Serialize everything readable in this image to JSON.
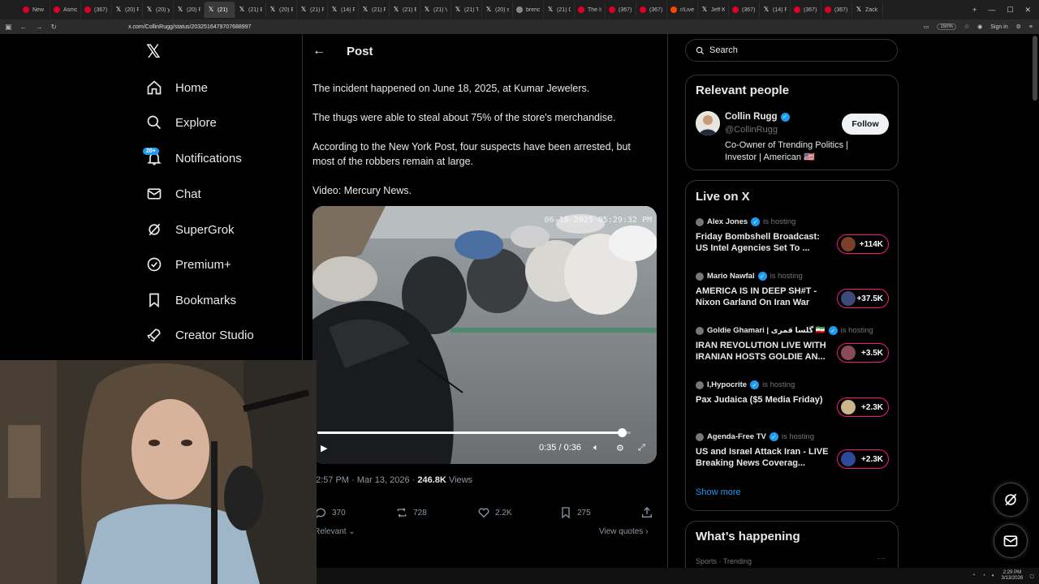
{
  "browser": {
    "tabs": [
      {
        "label": "New",
        "icon": "youtube"
      },
      {
        "label": "Asmo",
        "icon": "youtube"
      },
      {
        "label": "(367)",
        "icon": "youtube"
      },
      {
        "label": "(20) F",
        "icon": "x"
      },
      {
        "label": "(20) y",
        "icon": "x"
      },
      {
        "label": "(20) F",
        "icon": "x"
      },
      {
        "label": "(21) ",
        "icon": "x",
        "active": true
      },
      {
        "label": "(21) E",
        "icon": "x"
      },
      {
        "label": "(20) E",
        "icon": "x"
      },
      {
        "label": "(21) F",
        "icon": "x"
      },
      {
        "label": "(14) F",
        "icon": "x"
      },
      {
        "label": "(21) F",
        "icon": "x"
      },
      {
        "label": "(21) E",
        "icon": "x"
      },
      {
        "label": "(21) V",
        "icon": "x"
      },
      {
        "label": "(21) T",
        "icon": "x"
      },
      {
        "label": "(20) s",
        "icon": "x"
      },
      {
        "label": "brenc",
        "icon": "globe"
      },
      {
        "label": "(21) C",
        "icon": "x"
      },
      {
        "label": "The Is",
        "icon": "youtube"
      },
      {
        "label": "(367)",
        "icon": "youtube"
      },
      {
        "label": "(367)",
        "icon": "youtube"
      },
      {
        "label": "r/Livel",
        "icon": "reddit"
      },
      {
        "label": "Jeff K",
        "icon": "x"
      },
      {
        "label": "(367)",
        "icon": "youtube"
      },
      {
        "label": "(14) F",
        "icon": "x"
      },
      {
        "label": "(367)",
        "icon": "youtube"
      },
      {
        "label": "(367)",
        "icon": "youtube"
      },
      {
        "label": "Zack",
        "icon": "x"
      }
    ],
    "url": "x.com/CollinRugg/status/2032516479707688997",
    "zoom": "150%",
    "signin_label": "Sign in"
  },
  "nav": {
    "items": [
      {
        "label": "Home",
        "icon": "home-icon"
      },
      {
        "label": "Explore",
        "icon": "search-icon"
      },
      {
        "label": "Notifications",
        "icon": "bell-icon"
      },
      {
        "label": "Chat",
        "icon": "mail-icon"
      },
      {
        "label": "SuperGrok",
        "icon": "grok-icon"
      },
      {
        "label": "Premium+",
        "icon": "verified-badge-icon"
      },
      {
        "label": "Bookmarks",
        "icon": "bookmark-icon"
      },
      {
        "label": "Creator Studio",
        "icon": "rocket-icon"
      }
    ],
    "notifications_badge": "20+"
  },
  "post": {
    "header_title": "Post",
    "paragraphs": [
      "The incident happened on June 18, 2025, at Kumar Jewelers.",
      "The thugs were able to steal about 75% of the store's merchandise.",
      "According to the New York Post, four suspects have been arrested, but most of the robbers remain at large.",
      "Video: Mercury News."
    ],
    "video": {
      "timestamp_overlay": "06-18-2025 05:29:32 PM",
      "current_time": "0:35",
      "duration": "0:36",
      "time_display": "0:35 / 0:36",
      "progress_fraction": 0.972
    },
    "meta_time": "2:57 PM · Mar 13, 2026 · ",
    "views_count": "246.8K",
    "views_label": " Views",
    "actions": {
      "replies": "370",
      "reposts": "728",
      "likes": "2.2K",
      "bookmarks": "275"
    },
    "sort_label": "Relevant",
    "view_quotes": "View quotes"
  },
  "right": {
    "search_placeholder": "Search",
    "relevant_people": {
      "title": "Relevant people",
      "name": "Collin Rugg",
      "handle": "@CollinRugg",
      "bio": "Co-Owner of Trending Politics | Investor | American 🇺🇸",
      "follow_label": "Follow"
    },
    "live": {
      "title": "Live on X",
      "hosting_label": "is hosting",
      "items": [
        {
          "host": "Alex Jones",
          "title": "Friday Bombshell Broadcast: US Intel Agencies Set To ...",
          "count": "+114K",
          "color": "#7a3e2a"
        },
        {
          "host": "Mario Nawfal",
          "title": "AMERICA IS IN DEEP SH#T - Nixon Garland On Iran War",
          "count": "+37.5K",
          "color": "#3b4a7a"
        },
        {
          "host": "Goldie Ghamari | گلسا قمری 🇮🇷",
          "title": "IRAN REVOLUTION LIVE WITH IRANIAN HOSTS GOLDIE AN...",
          "count": "+3.5K",
          "color": "#8a4a5a"
        },
        {
          "host": "I,Hypocrite",
          "title": "Pax Judaica ($5 Media Friday)",
          "count": "+2.3K",
          "color": "#c9b68a"
        },
        {
          "host": "Agenda-Free TV",
          "title": "US and Israel Attack Iran - LIVE Breaking News Coverag...",
          "count": "+2.3K",
          "color": "#2d4a9a"
        }
      ],
      "show_more": "Show more"
    },
    "whats_happening": {
      "title": "What’s happening",
      "subline": "Sports · Trending"
    }
  },
  "taskbar": {
    "time": "2:29 PM",
    "date": "3/13/2026"
  }
}
